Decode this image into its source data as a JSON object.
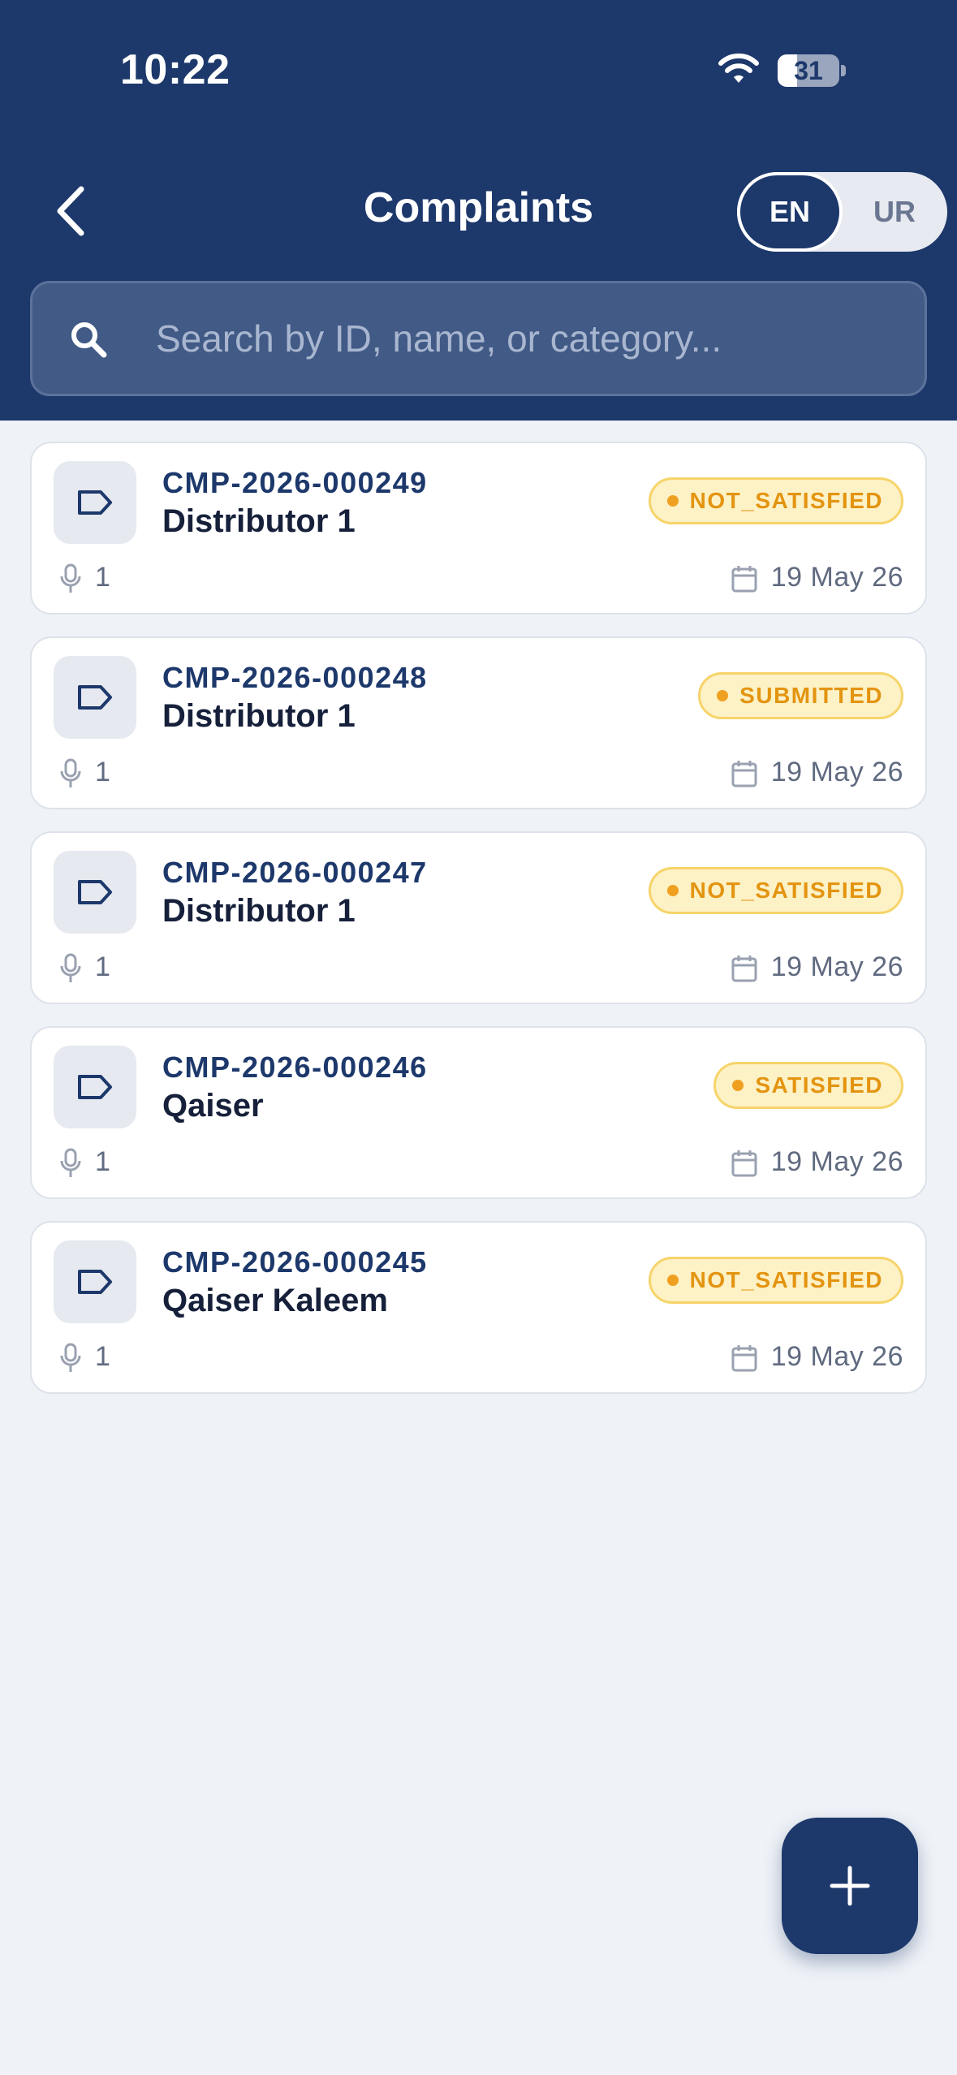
{
  "status_bar": {
    "time": "10:22",
    "battery_level": "31",
    "battery_fraction": 0.31
  },
  "header": {
    "title": "Complaints",
    "language": {
      "options": [
        "EN",
        "UR"
      ],
      "selected": "EN"
    }
  },
  "search": {
    "placeholder": "Search by ID, name, or category...",
    "value": ""
  },
  "complaints": [
    {
      "id": "CMP-2026-000249",
      "name": "Distributor 1",
      "status": "NOT_SATISFIED",
      "voice_count": "1",
      "date": "19 May 26"
    },
    {
      "id": "CMP-2026-000248",
      "name": "Distributor 1",
      "status": "SUBMITTED",
      "voice_count": "1",
      "date": "19 May 26"
    },
    {
      "id": "CMP-2026-000247",
      "name": "Distributor 1",
      "status": "NOT_SATISFIED",
      "voice_count": "1",
      "date": "19 May 26"
    },
    {
      "id": "CMP-2026-000246",
      "name": "Qaiser",
      "status": "SATISFIED",
      "voice_count": "1",
      "date": "19 May 26"
    },
    {
      "id": "CMP-2026-000245",
      "name": "Qaiser Kaleem",
      "status": "NOT_SATISFIED",
      "voice_count": "1",
      "date": "19 May 26"
    }
  ],
  "icons": {
    "back": "chevron-left-icon",
    "search": "search-icon",
    "card": "tag-icon",
    "voice": "microphone-icon",
    "date": "calendar-icon",
    "add": "plus-icon"
  },
  "colors": {
    "brand": "#1d386b",
    "background": "#eff2f7",
    "badge_bg": "#fdf1c6",
    "badge_text": "#e39410"
  }
}
